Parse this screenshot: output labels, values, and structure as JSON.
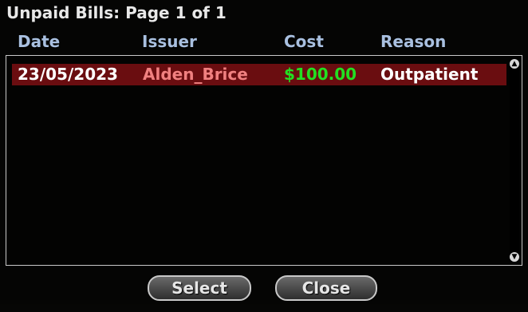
{
  "window": {
    "title": "Unpaid Bills: Page 1 of 1"
  },
  "columns": [
    "Date",
    "Issuer",
    "Cost",
    "Reason"
  ],
  "rows": [
    {
      "date": "23/05/2023",
      "issuer": "Alden_Brice",
      "cost": "$100.00",
      "reason": "Outpatient"
    }
  ],
  "buttons": {
    "select": "Select",
    "close": "Close"
  },
  "colors": {
    "selected_row": "#6a0d10",
    "date": "#ffffff",
    "issuer": "#f08080",
    "cost": "#22e022",
    "reason": "#ffffff",
    "header": "#a9c0e0"
  },
  "icons": {
    "scroll_up": "scroll-up-icon",
    "scroll_down": "scroll-down-icon"
  }
}
